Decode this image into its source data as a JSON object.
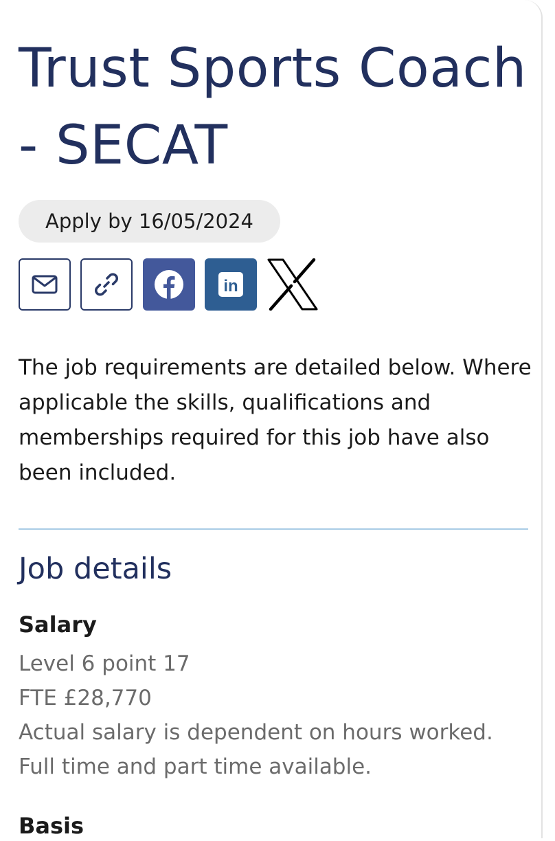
{
  "job": {
    "title": "Trust Sports Coach - SECAT",
    "apply_by": "Apply by 16/05/2024"
  },
  "share": {
    "icons": [
      "envelope-icon",
      "link-icon",
      "facebook-icon",
      "linkedin-icon",
      "x-logo-icon"
    ],
    "linkedin_text": "in",
    "colors": {
      "outline": "#2a3a68",
      "facebook": "#43589b",
      "linkedin": "#2e5e92"
    }
  },
  "intro": "The job requirements are detailed below. Where applicable the skills, qualifications and memberships required for this job have also been included.",
  "details": {
    "heading": "Job details",
    "salary": {
      "label": "Salary",
      "lines": [
        "Level 6 point 17",
        "FTE £28,770",
        "Actual salary is dependent on hours worked.",
        "Full time and part time available."
      ]
    },
    "next_label": "Basis"
  },
  "colors": {
    "heading": "#22305e",
    "divider": "#a9cce6",
    "muted_text": "#6b6b6b"
  }
}
